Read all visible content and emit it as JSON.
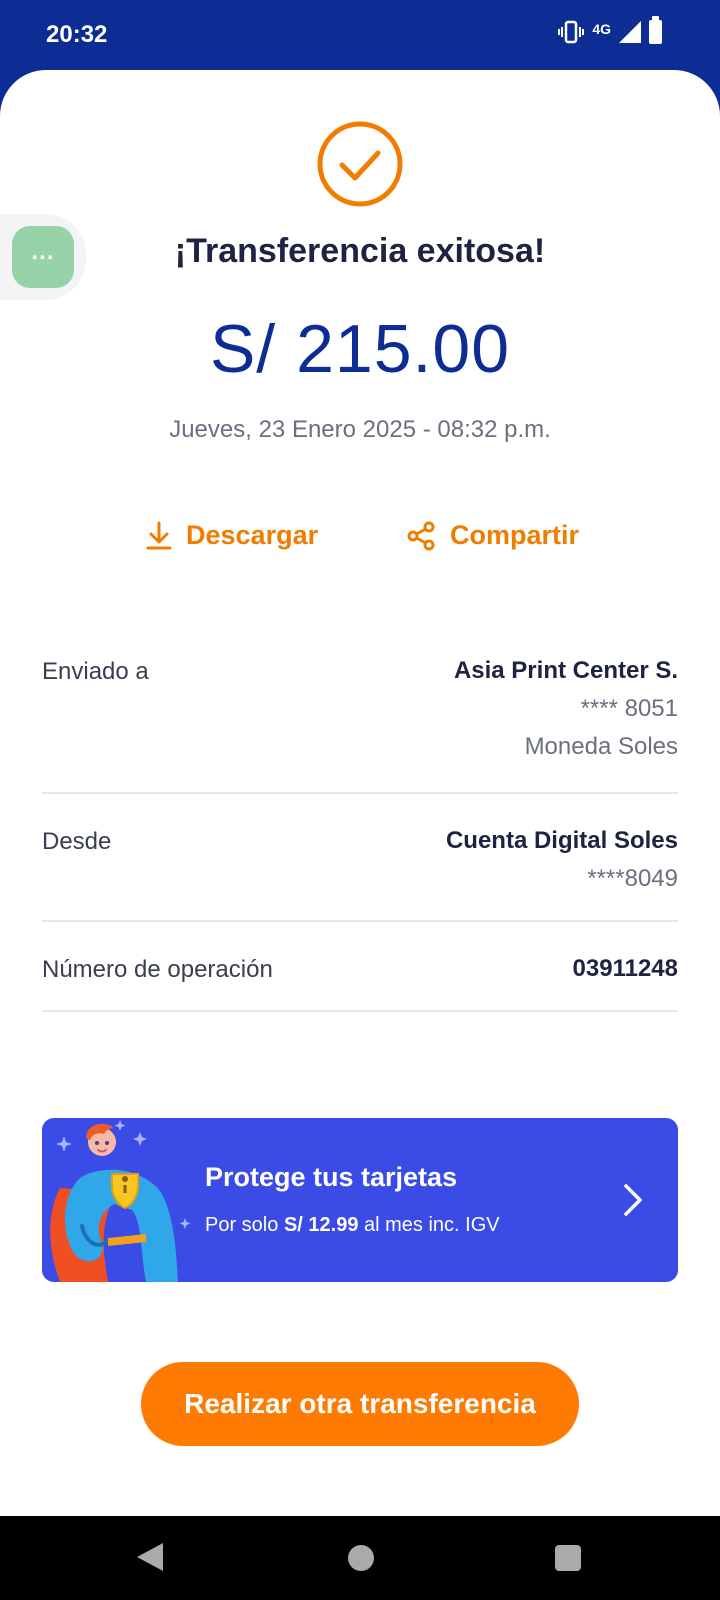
{
  "status_bar": {
    "time": "20:32",
    "network": "4G",
    "icons": [
      "vibrate-icon",
      "signal-icon",
      "battery-icon"
    ]
  },
  "receipt": {
    "title": "¡Transferencia exitosa!",
    "amount": "S/ 215.00",
    "datetime": "Jueves, 23 Enero 2025 - 08:32 p.m.",
    "success_icon": "check-circle-icon"
  },
  "actions": {
    "download_label": "Descargar",
    "share_label": "Compartir"
  },
  "details": {
    "sent_to": {
      "label": "Enviado a",
      "name": "Asia Print Center S.",
      "account": "**** 8051",
      "currency": "Moneda Soles"
    },
    "from": {
      "label": "Desde",
      "name": "Cuenta Digital Soles",
      "account": "****8049"
    },
    "operation": {
      "label": "Número de operación",
      "value": "03911248"
    }
  },
  "promo": {
    "title": "Protege tus tarjetas",
    "sub_prefix": "Por solo ",
    "sub_price": "S/ 12.99",
    "sub_suffix": " al mes inc. IGV"
  },
  "cta": {
    "label": "Realizar otra transferencia"
  },
  "colors": {
    "brand_blue": "#0d2d94",
    "accent_orange": "#ff7a00",
    "promo_blue": "#3a4be6"
  }
}
